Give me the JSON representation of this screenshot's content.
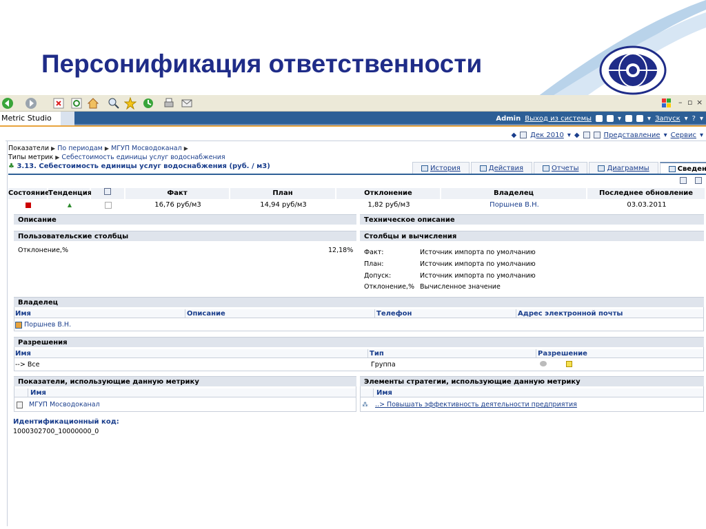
{
  "slide": {
    "title": "Персонификация ответственности"
  },
  "browser": {
    "min": "–",
    "restore": "▫",
    "close": "×"
  },
  "app": {
    "name": "Metric Studio",
    "user": "Admin",
    "logout": "Выход из системы",
    "launch": "Запуск",
    "help": "?"
  },
  "toolbar": {
    "period": "Дек 2010",
    "view": "Представление",
    "service": "Сервис"
  },
  "breadcrumb": {
    "line1": [
      "Показатели",
      "По периодам",
      "МГУП Мосводоканал"
    ],
    "line2_label": "Типы метрик",
    "line2_link": "Себестоимость единицы услуг водоснабжения"
  },
  "metric": {
    "title": "3.13. Себестоимость единицы услуг водоснабжения (руб. / м3)"
  },
  "tabs": [
    "История",
    "Действия",
    "Отчеты",
    "Диаграммы",
    "Сведения"
  ],
  "summary": {
    "headers": {
      "state": "Состояние",
      "trend": "Тенденция",
      "fact": "Факт",
      "plan": "План",
      "deviation": "Отклонение",
      "owner": "Владелец",
      "updated": "Последнее обновление"
    },
    "row": {
      "fact": "16,76 руб/м3",
      "plan": "14,94 руб/м3",
      "deviation": "1,82 руб/м3",
      "owner": "Поршнев В.Н.",
      "updated": "03.03.2011"
    }
  },
  "description": {
    "title": "Описание"
  },
  "tech_description": {
    "title": "Техническое описание"
  },
  "user_columns": {
    "title": "Пользовательские столбцы",
    "items": [
      {
        "label": "Отклонение,%",
        "value": "12,18%"
      }
    ]
  },
  "calc_columns": {
    "title": "Столбцы и вычисления",
    "items": [
      {
        "label": "Факт:",
        "value": "Источник импорта по умолчанию"
      },
      {
        "label": "План:",
        "value": "Источник импорта по умолчанию"
      },
      {
        "label": "Допуск:",
        "value": "Источник импорта по умолчанию"
      },
      {
        "label": "Отклонение,%",
        "value": "Вычисленное значение"
      }
    ]
  },
  "owner": {
    "title": "Владелец",
    "columns": {
      "name": "Имя",
      "description": "Описание",
      "phone": "Телефон",
      "email": "Адрес электронной почты"
    },
    "rows": [
      {
        "name": "Поршнев В.Н."
      }
    ]
  },
  "permissions": {
    "title": "Разрешения",
    "columns": {
      "name": "Имя",
      "type": "Тип",
      "permission": "Разрешение"
    },
    "rows": [
      {
        "prefix": "-->",
        "name": "Все",
        "type": "Группа"
      }
    ]
  },
  "indicators": {
    "title": "Показатели, использующие данную метрику",
    "column": "Имя",
    "rows": [
      "МГУП Мосводоканал"
    ]
  },
  "strategy": {
    "title": "Элементы стратегии, использующие данную метрику",
    "column": "Имя",
    "rows": [
      "..> Повышать эффективность деятельности предприятия"
    ]
  },
  "identifier": {
    "label": "Идентификационный код:",
    "value": "1000302700_10000000_0"
  },
  "colors": {
    "title": "#1f2c88",
    "header_bar": "#2d5f96",
    "accent": "#e8a33c",
    "link": "#1a3e8c",
    "status_red": "#cc0000",
    "trend_green": "#2e8b2e"
  }
}
